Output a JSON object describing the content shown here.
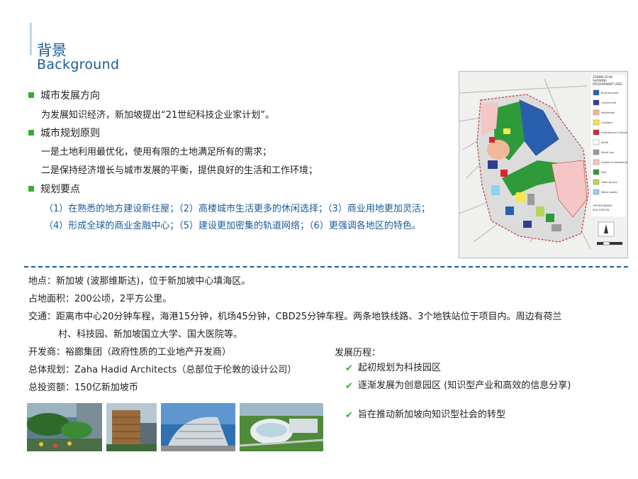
{
  "header": {
    "title_cn": "背景",
    "title_en": "Background"
  },
  "sections": [
    {
      "heading": "城市发展方向",
      "lines": [
        "为发展知识经济，新加坡提出“21世纪科技企业家计划”。"
      ]
    },
    {
      "heading": "城市规划原则",
      "lines": [
        "一是土地利用最优化，使用有限的土地满足所有的需求；",
        "二是保持经济增长与城市发展的平衡，提供良好的生活和工作环境；"
      ]
    },
    {
      "heading": "规划要点",
      "lines": [
        "（1）在熟悉的地方建设新住屋；（2）高楼城市生活更多的休闲选择；（3）商业用地更加灵活；",
        "（4）形成全球的商业金融中心；（5）建设更加密集的轨道网络；（6）更强调各地区的特色。"
      ]
    }
  ],
  "map": {
    "legend_title": "ZONING PLAN SHOWING PREDOMINANT USES (Interim)",
    "legend": [
      {
        "label": "Business park",
        "color": "#2a5fb0"
      },
      {
        "label": "Commercial",
        "color": "#2c3f8f"
      },
      {
        "label": "Residential",
        "color": "#f2b89a"
      },
      {
        "label": "LiveWork",
        "color": "#f6e84a"
      },
      {
        "label": "Institutional & Educational",
        "color": "#d8262e"
      },
      {
        "label": "White",
        "color": "#ffffff"
      },
      {
        "label": "Mixed Use",
        "color": "#9b9b9b"
      },
      {
        "label": "Subject to detailed planning",
        "color": "#f4c6c6"
      },
      {
        "label": "Park",
        "color": "#2f9a3a"
      },
      {
        "label": "Open spaces",
        "color": "#b9d35a"
      },
      {
        "label": "Water bodies",
        "color": "#8fd3ef"
      }
    ],
    "boundary_label": "OPP BOUNDARY",
    "station_label": "RAIL STATION",
    "scale_labels": [
      "0",
      "100",
      "200",
      "500m"
    ]
  },
  "info": [
    "地点：新加坡 (波那维斯达)，位于新加坡中心填海区。",
    "占地面积：200公顷，2平方公里。",
    "交通：距离市中心20分钟车程，海港15分钟，机场45分钟，CBD25分钟车程。两条地铁线路、3个地铁站位于项目内。周边有荷兰",
    "村、科技园、新加坡国立大学、国大医院等。",
    "开发商：裕廊集团（政府性质的工业地产开发商）",
    "总体规划：Zaha Hadid Architects（总部位于伦敦的设计公司）",
    "总投资额：150亿新加坡币"
  ],
  "history": {
    "title": "发展历程：",
    "items": [
      "起初规划为科技园区",
      "逐渐发展为创意园区 (知识型产业和高效的信息分享)",
      "旨在推动新加坡向知识型社会的转型"
    ]
  },
  "colors": {
    "accent_blue": "#1a5a9a",
    "bullet_green": "#3aaa35"
  },
  "photos": [
    "garden-walkway-photo",
    "tower-building-photo",
    "curved-building-photo",
    "aerial-campus-photo"
  ]
}
